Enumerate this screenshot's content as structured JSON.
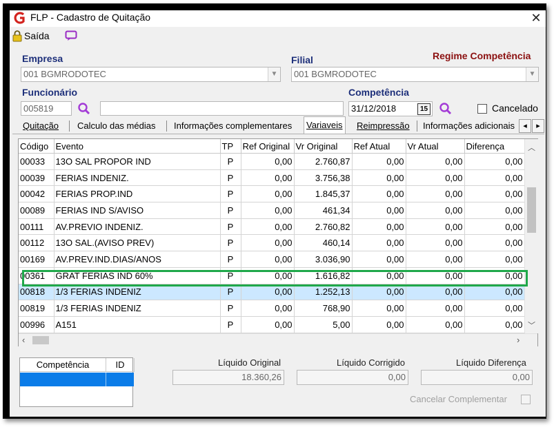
{
  "window": {
    "title": "FLP - Cadastro de Quitação",
    "close_glyph": "✕"
  },
  "toolbar": {
    "exit_label": "Saída",
    "exit_icon": "lock-icon",
    "chat_icon": "chat-icon"
  },
  "header": {
    "empresa_label": "Empresa",
    "empresa_value": "001 BGMRODOTEC",
    "filial_label": "Filial",
    "filial_value": "001 BGMRODOTEC",
    "regime_label": "Regime Competência",
    "funcionario_label": "Funcionário",
    "funcionario_value": "005819",
    "competencia_label": "Competência",
    "competencia_value": "31/12/2018",
    "calendar_badge": "15",
    "cancelado_label": "Cancelado"
  },
  "tabs": [
    "Quitação",
    "Calculo das médias",
    "Informações complementares",
    "Variaveis",
    "Reimpressão",
    "Informações adicionais"
  ],
  "tab_scroll": {
    "left": "◂",
    "right": "▸"
  },
  "grid": {
    "columns": [
      "Código",
      "Evento",
      "TP",
      "Ref Original",
      "Vr Original",
      "Ref Atual",
      "Vr Atual",
      "Diferença"
    ],
    "rows": [
      [
        "00033",
        "13O SAL PROPOR IND",
        "P",
        "0,00",
        "2.760,87",
        "0,00",
        "0,00",
        "0,00"
      ],
      [
        "00039",
        "FERIAS INDENIZ.",
        "P",
        "0,00",
        "3.756,38",
        "0,00",
        "0,00",
        "0,00"
      ],
      [
        "00042",
        "FERIAS PROP.IND",
        "P",
        "0,00",
        "1.845,37",
        "0,00",
        "0,00",
        "0,00"
      ],
      [
        "00089",
        "FERIAS IND S/AVISO",
        "P",
        "0,00",
        "461,34",
        "0,00",
        "0,00",
        "0,00"
      ],
      [
        "00111",
        "AV.PREVIO INDENIZ.",
        "P",
        "0,00",
        "2.760,82",
        "0,00",
        "0,00",
        "0,00"
      ],
      [
        "00112",
        "13O SAL.(AVISO PREV)",
        "P",
        "0,00",
        "460,14",
        "0,00",
        "0,00",
        "0,00"
      ],
      [
        "00169",
        "AV.PREV.IND.DIAS/ANOS",
        "P",
        "0,00",
        "3.036,90",
        "0,00",
        "0,00",
        "0,00"
      ],
      [
        "00361",
        "GRAT FERIAS IND 60%",
        "P",
        "0,00",
        "1.616,82",
        "0,00",
        "0,00",
        "0,00"
      ],
      [
        "00818",
        "1/3 FERIAS INDENIZ",
        "P",
        "0,00",
        "1.252,13",
        "0,00",
        "0,00",
        "0,00"
      ],
      [
        "00819",
        "1/3 FERIAS INDENIZ",
        "P",
        "0,00",
        "768,90",
        "0,00",
        "0,00",
        "0,00"
      ],
      [
        "00996",
        "A151",
        "P",
        "0,00",
        "5,00",
        "0,00",
        "0,00",
        "0,00"
      ]
    ],
    "selected_row": 8,
    "highlighted_row": 7
  },
  "mini_table": {
    "columns": [
      "Competência",
      "ID"
    ]
  },
  "summary": {
    "liquido_original_label": "Líquido Original",
    "liquido_original_value": "18.360,26",
    "liquido_corrigido_label": "Líquido Corrigido",
    "liquido_corrigido_value": "0,00",
    "liquido_diferenca_label": "Líquido Diferença",
    "liquido_diferenca_value": "0,00",
    "cancelar_label": "Cancelar Complementar"
  },
  "colors": {
    "label_blue": "#1d2f7a",
    "label_red": "#8b1010",
    "highlight": "#1fa84a",
    "selection": "#cce8ff"
  }
}
